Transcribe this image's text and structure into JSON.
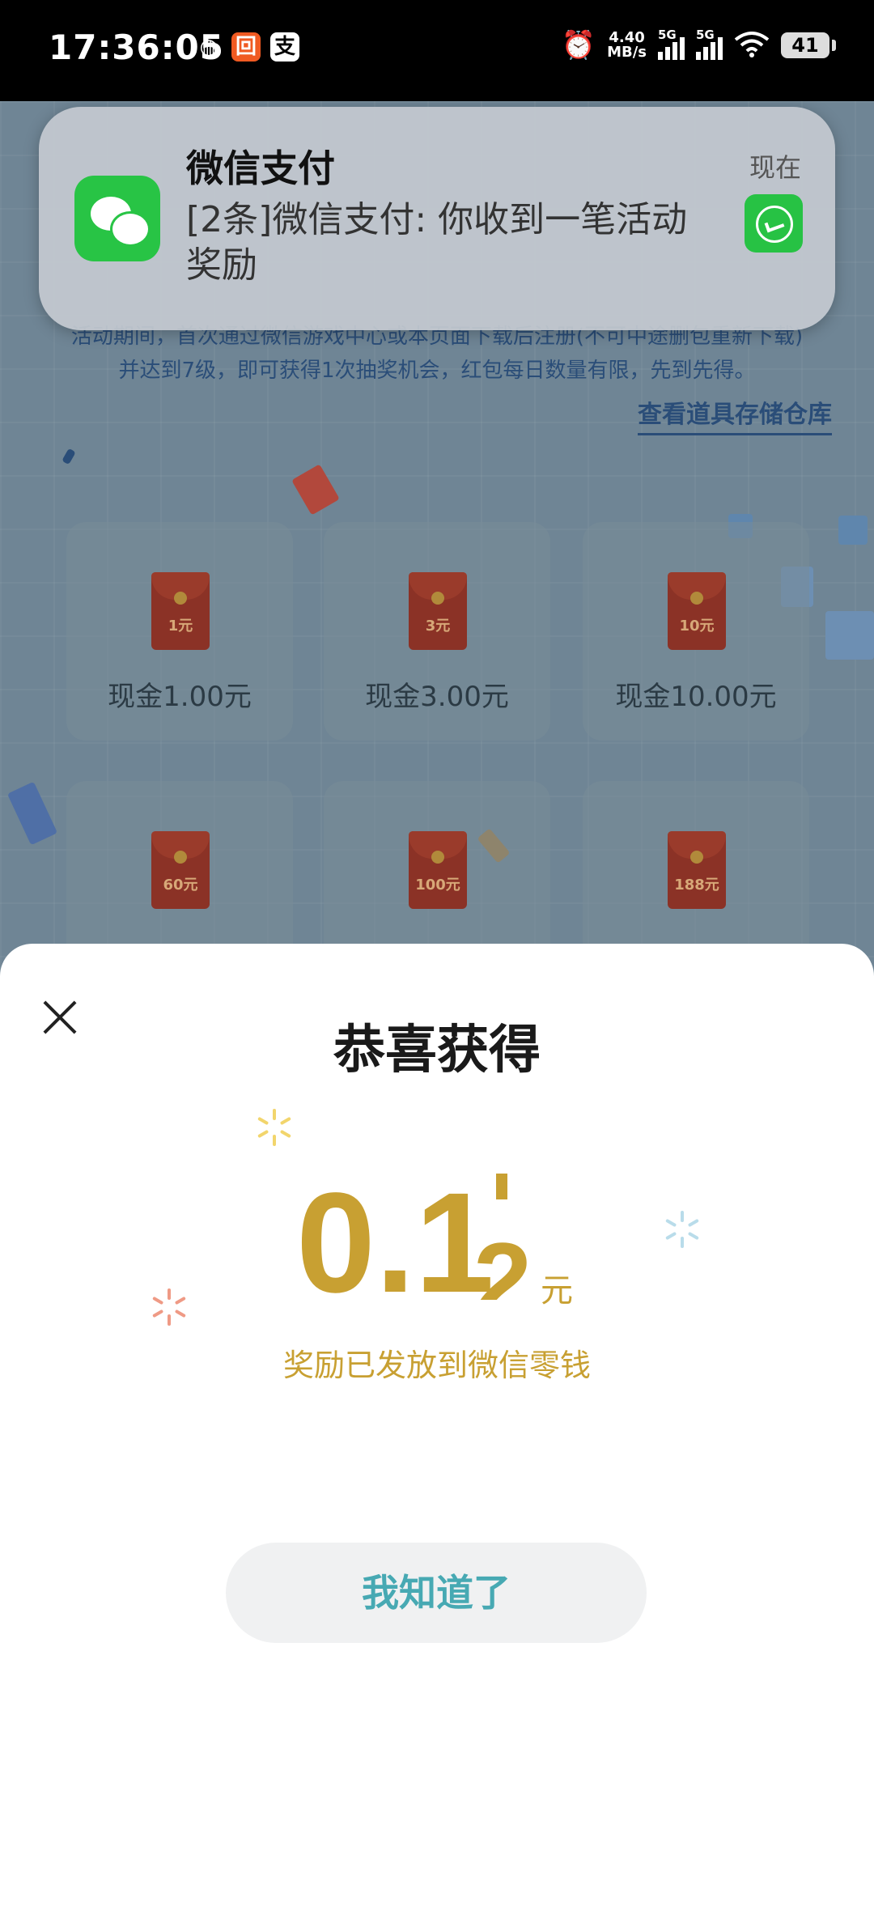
{
  "status_bar": {
    "time": "17:36:05",
    "app_icons": [
      "wechat-icon",
      "orange-app-icon",
      "alipay-icon"
    ],
    "net_speed_value": "4.40",
    "net_speed_unit": "MB/s",
    "sim1_label": "5G",
    "sim2_label": "5G",
    "battery": "41"
  },
  "background_page": {
    "rules_line1": "活动期间，首次通过微信游戏中心或本页面下载后注册(不可中途删包重新下载)",
    "rules_line2": "并达到7级，即可获得1次抽奖机会，红包每日数量有限，先到先得。",
    "link": "查看道具存储仓库",
    "prizes": [
      {
        "envelope": "1元",
        "label": "现金1.00元"
      },
      {
        "envelope": "3元",
        "label": "现金3.00元"
      },
      {
        "envelope": "10元",
        "label": "现金10.00元"
      },
      {
        "envelope": "60元",
        "label": ""
      },
      {
        "envelope": "100元",
        "label": ""
      },
      {
        "envelope": "188元",
        "label": ""
      }
    ]
  },
  "notification": {
    "title": "微信支付",
    "body": "[2条]微信支付: 你收到一笔活动奖励",
    "time": "现在"
  },
  "result_sheet": {
    "title": "恭喜获得",
    "amount": "0.1",
    "amount_rolling_digit": "2",
    "unit": "元",
    "subtitle": "奖励已发放到微信零钱",
    "button": "我知道了"
  },
  "colors": {
    "gold": "#c8a032",
    "button_text": "#47a9b3",
    "wechat_green": "#28c445"
  }
}
